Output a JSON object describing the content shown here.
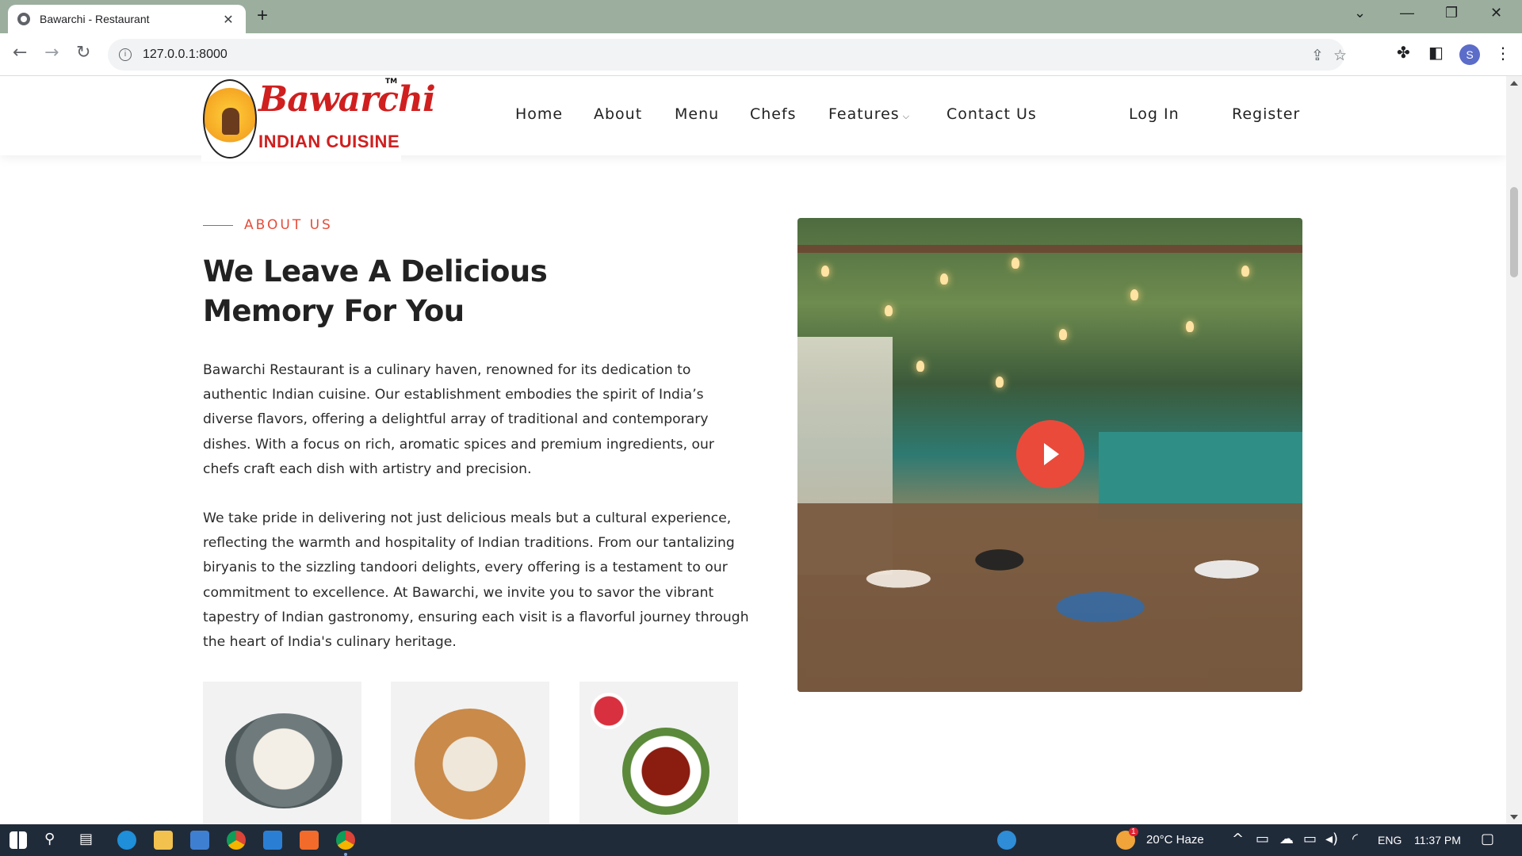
{
  "browser": {
    "tab_title": "Bawarchi - Restaurant",
    "tab_close": "✕",
    "new_tab": "+",
    "url": "127.0.0.1:8000",
    "profile_initial": "S",
    "window_controls": [
      "⌄",
      "—",
      "❐",
      "✕"
    ]
  },
  "site": {
    "logo": {
      "brand": "Bawarchi",
      "subtitle": "INDIAN CUISINE",
      "tm": "TM"
    },
    "nav": [
      {
        "label": "Home"
      },
      {
        "label": "About"
      },
      {
        "label": "Menu"
      },
      {
        "label": "Chefs"
      },
      {
        "label": "Features",
        "caret": "⌵"
      },
      {
        "label": "Contact Us"
      }
    ],
    "auth": {
      "login": "Log In",
      "register": "Register"
    },
    "about": {
      "label": "ABOUT US",
      "headline_line1": "We Leave A Delicious",
      "headline_line2": "Memory For You",
      "paragraph1": "Bawarchi Restaurant is a culinary haven, renowned for its dedication to authentic Indian cuisine. Our establishment embodies the spirit of India’s diverse flavors, offering a delightful array of traditional and contemporary dishes. With a focus on rich, aromatic spices and premium ingredients, our chefs craft each dish with artistry and precision.",
      "paragraph2": "We take pride in delivering not just delicious meals but a cultural experience, reflecting the warmth and hospitality of Indian traditions. From our tantalizing biryanis to the sizzling tandoori delights, every offering is a testament to our commitment to excellence. At Bawarchi, we invite you to savor the vibrant tapestry of Indian gastronomy, ensuring each visit is a flavorful journey through the heart of India's culinary heritage."
    }
  },
  "taskbar": {
    "weather": "20°C  Haze",
    "weather_badge": "1",
    "language": "ENG",
    "time": "11:37 PM"
  },
  "colors": {
    "accent": "#e44d3a",
    "brand_red": "#d01f1f",
    "tabbar": "#9caf9e"
  }
}
